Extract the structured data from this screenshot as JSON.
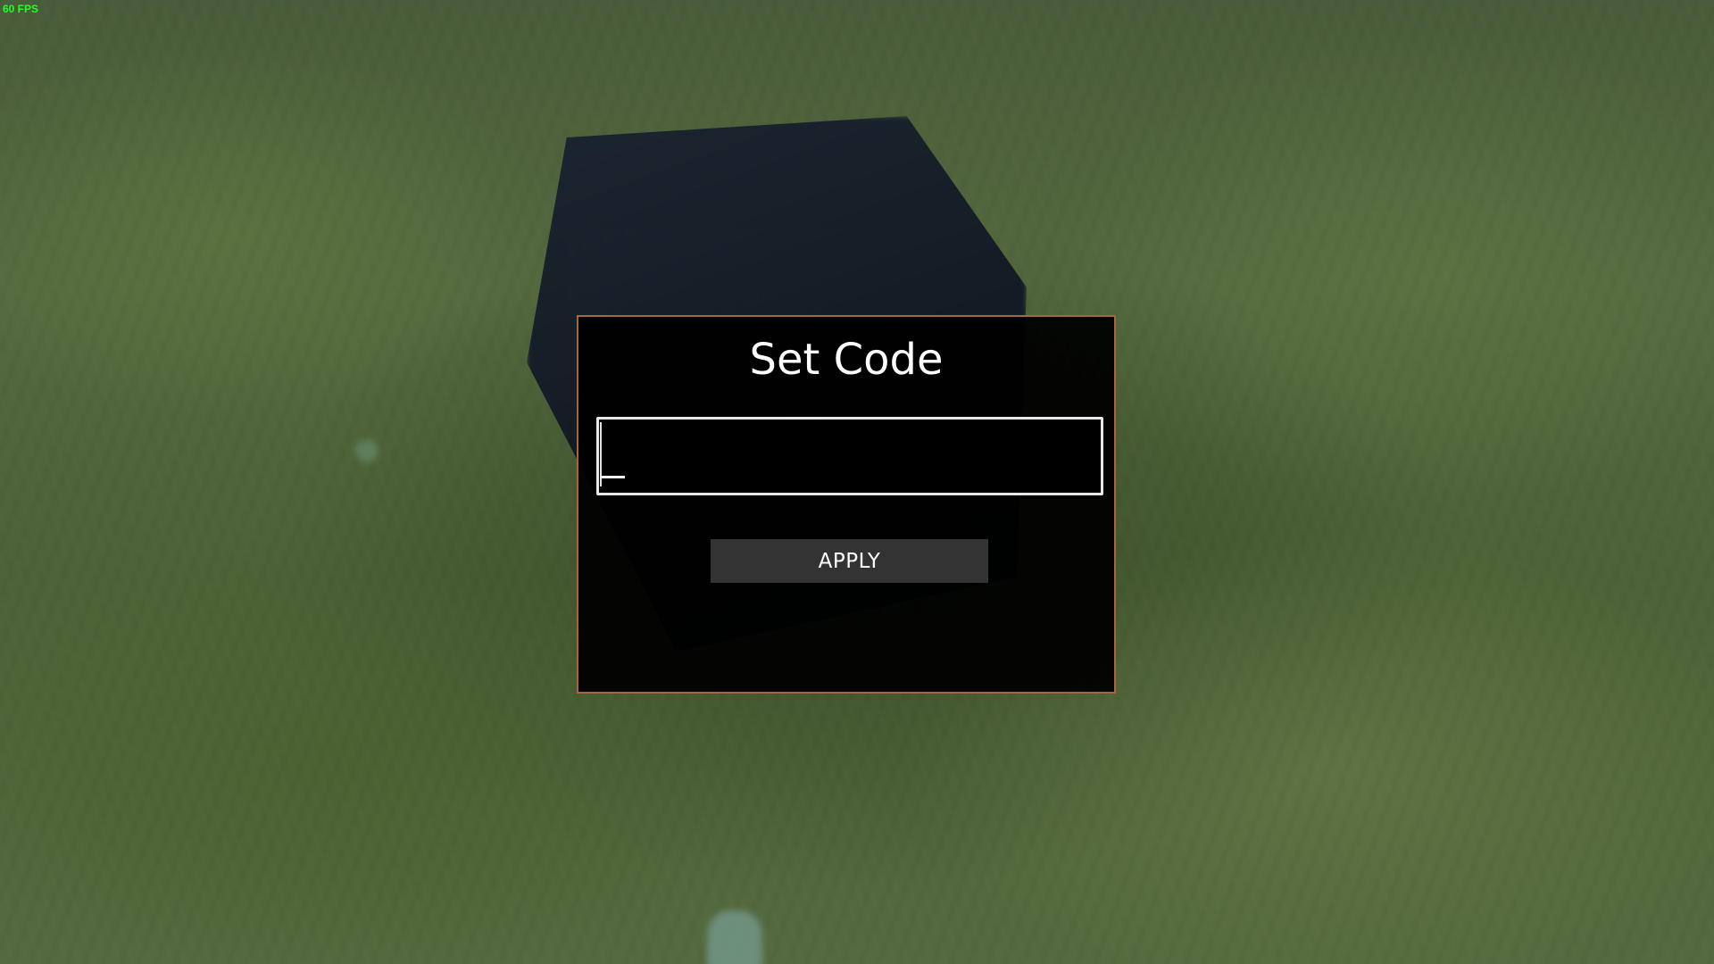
{
  "hud": {
    "fps_label": "60 FPS",
    "fps_color": "#22ff22"
  },
  "dialog": {
    "title": "Set Code",
    "code_input": {
      "value": "",
      "placeholder": ""
    },
    "apply_label": "APPLY",
    "border_color": "#a8663f"
  }
}
